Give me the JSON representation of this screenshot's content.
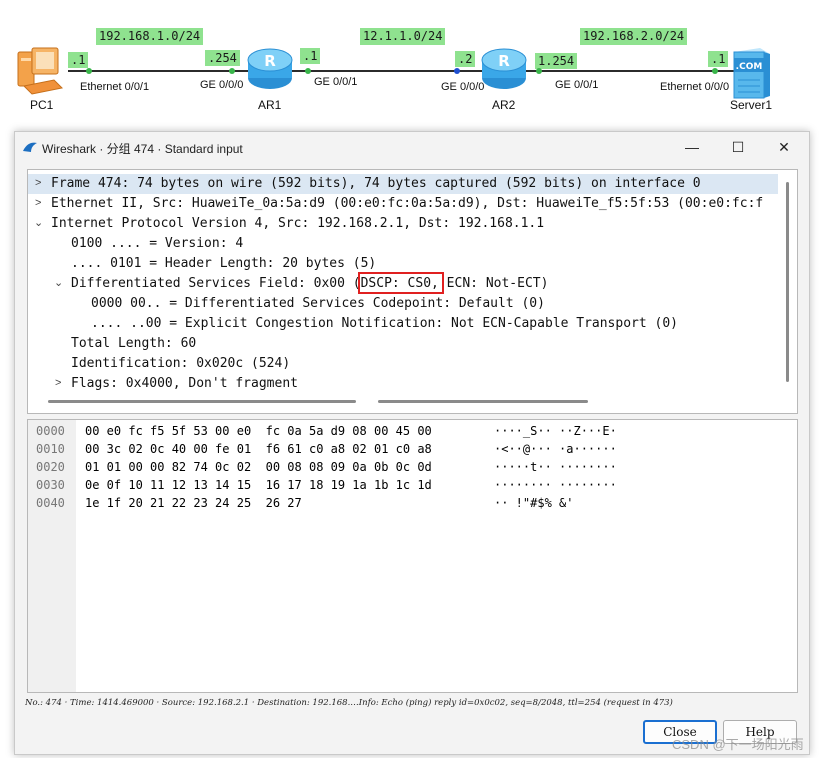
{
  "topology": {
    "networks": [
      "192.168.1.0/24",
      "12.1.1.0/24",
      "192.168.2.0/24"
    ],
    "ips": [
      ".1",
      ".254",
      ".1",
      ".2",
      "1.254",
      ".1"
    ],
    "ports": [
      "Ethernet 0/0/1",
      "GE 0/0/0",
      "GE 0/0/1",
      "GE 0/0/0",
      "GE 0/0/1",
      "Ethernet 0/0/0"
    ],
    "devices": [
      "PC1",
      "AR1",
      "AR2",
      "Server1"
    ],
    "server_badge": ".COM",
    "router_letter": "R"
  },
  "window": {
    "title": "Wireshark · 分组 474 · Standard input",
    "minimize": "—",
    "maximize": "☐",
    "close": "✕"
  },
  "details": {
    "rows": [
      "Frame 474: 74 bytes on wire (592 bits), 74 bytes captured (592 bits) on interface 0",
      "Ethernet II, Src: HuaweiTe_0a:5a:d9 (00:e0:fc:0a:5a:d9), Dst: HuaweiTe_f5:5f:53 (00:e0:fc:f",
      "Internet Protocol Version 4, Src: 192.168.2.1, Dst: 192.168.1.1",
      "0100 .... = Version: 4",
      ".... 0101 = Header Length: 20 bytes (5)",
      "Differentiated Services Field: 0x00 (DSCP: CS0, ECN: Not-ECT)",
      "0000 00.. = Differentiated Services Codepoint: Default (0)",
      ".... ..00 = Explicit Congestion Notification: Not ECN-Capable Transport (0)",
      "Total Length: 60",
      "Identification: 0x020c (524)",
      "Flags: 0x4000, Don't fragment"
    ],
    "highlight": "(DSCP: CS0,"
  },
  "bytes": {
    "offsets": [
      "0000",
      "0010",
      "0020",
      "0030",
      "0040"
    ],
    "hex": [
      "00 e0 fc f5 5f 53 00 e0  fc 0a 5a d9 08 00 45 00",
      "00 3c 02 0c 40 00 fe 01  f6 61 c0 a8 02 01 c0 a8",
      "01 01 00 00 82 74 0c 02  00 08 08 09 0a 0b 0c 0d",
      "0e 0f 10 11 12 13 14 15  16 17 18 19 1a 1b 1c 1d",
      "1e 1f 20 21 22 23 24 25  26 27"
    ],
    "ascii": [
      "····_S·· ··Z···E·",
      "·<··@··· ·a······",
      "·····t·· ········",
      "········ ········",
      "·· !\"#$% &'"
    ]
  },
  "status_line": "No.: 474 · Time: 1414.469000 · Source: 192.168.2.1 · Destination: 192.168.…Info: Echo (ping) reply id=0x0c02, seq=8/2048, ttl=254 (request in 473)",
  "buttons": {
    "close": "Close",
    "help": "Help"
  },
  "watermark": "CSDN @下一场阳光雨",
  "colors": {
    "selected_row": "#dbe7f3",
    "highlight_box": "#e02020",
    "network_label": "#8fe28f"
  }
}
